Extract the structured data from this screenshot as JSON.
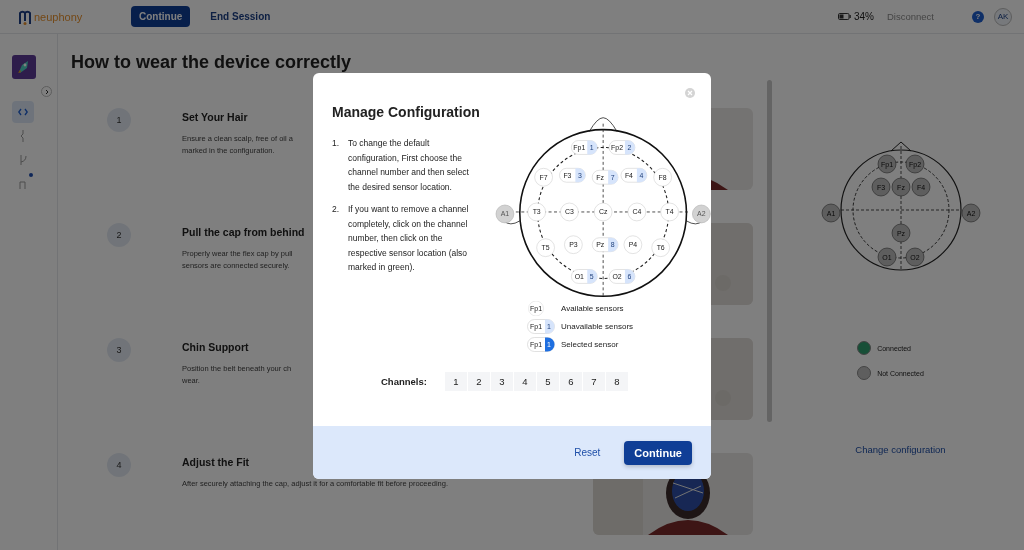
{
  "top_bar": {
    "logo": "neuphony",
    "continue_button": "Continue",
    "end_session": "End Session",
    "battery": "34%",
    "disconnect": {
      "label": "Disconnect",
      "disabled": true
    },
    "help": "?",
    "avatar": "AK"
  },
  "sidebar": {
    "nav": [
      {
        "kind": "code",
        "selected": true,
        "notification": false
      },
      {
        "kind": "pulse",
        "selected": false,
        "notification": false
      },
      {
        "kind": "branch",
        "selected": false,
        "notification": false
      },
      {
        "kind": "route",
        "selected": false,
        "notification": true
      }
    ]
  },
  "page_title": "How to wear the device correctly",
  "steps": [
    {
      "number": "1",
      "title": "Set Your Hair",
      "lines": [
        "Ensure a clean scalp, free of oil a",
        "marked in the configuration."
      ]
    },
    {
      "number": "2",
      "title": "Pull the cap from behind",
      "lines": [
        "Properly wear the flex cap by pull",
        "sensors are connected securely."
      ]
    },
    {
      "number": "3",
      "title": "Chin Support",
      "lines": [
        "Position the belt beneath your ch",
        "wear."
      ]
    },
    {
      "number": "4",
      "title": "Adjust the Fit",
      "lines": [
        "After securely attaching the cap, adjust it for a comfortable fit before proceeding."
      ]
    }
  ],
  "right_panel": {
    "sensors": [
      {
        "label": "Fp1",
        "connected": false
      },
      {
        "label": "Fp2",
        "connected": false
      },
      {
        "label": "F3",
        "connected": false
      },
      {
        "label": "Fz",
        "connected": false
      },
      {
        "label": "F4",
        "connected": false
      },
      {
        "label": "Pz",
        "connected": false
      },
      {
        "label": "O1",
        "connected": false
      },
      {
        "label": "O2",
        "connected": false
      },
      {
        "label": "A1",
        "connected": false
      },
      {
        "label": "A2",
        "connected": false
      }
    ],
    "legend": [
      {
        "kind": "connected",
        "label": "Connected"
      },
      {
        "kind": "not_connected",
        "label": "Not Connected"
      }
    ],
    "link": "Change configuration"
  },
  "dialog": {
    "title": "Manage Configuration",
    "instructions": [
      {
        "number": "1.",
        "text": "To change the default configuration, First choose the channel number and then select the desired sensor location."
      },
      {
        "number": "2.",
        "text": "If you want to remove a channel completely, click on the channel number, then click on the respective sensor location (also marked in green)."
      }
    ],
    "sensors": [
      {
        "label": "Fp1",
        "kind": "electrode",
        "channel": "1",
        "selected": false
      },
      {
        "label": "Fp2",
        "kind": "electrode",
        "channel": "2",
        "selected": false
      },
      {
        "label": "F7",
        "kind": "electrode",
        "selected": false
      },
      {
        "label": "F3",
        "kind": "electrode",
        "channel": "3",
        "selected": false
      },
      {
        "label": "Fz",
        "kind": "electrode",
        "channel": "7",
        "selected": false
      },
      {
        "label": "F4",
        "kind": "electrode",
        "channel": "4",
        "selected": false
      },
      {
        "label": "F8",
        "kind": "electrode",
        "selected": false
      },
      {
        "label": "T3",
        "kind": "electrode",
        "selected": false
      },
      {
        "label": "C3",
        "kind": "electrode",
        "selected": false
      },
      {
        "label": "Cz",
        "kind": "electrode",
        "selected": false
      },
      {
        "label": "C4",
        "kind": "electrode",
        "selected": false
      },
      {
        "label": "T4",
        "kind": "electrode",
        "selected": false
      },
      {
        "label": "T5",
        "kind": "electrode",
        "selected": false
      },
      {
        "label": "P3",
        "kind": "electrode",
        "selected": false
      },
      {
        "label": "Pz",
        "kind": "electrode",
        "channel": "8",
        "selected": false
      },
      {
        "label": "P4",
        "kind": "electrode",
        "selected": false
      },
      {
        "label": "T6",
        "kind": "electrode",
        "selected": false
      },
      {
        "label": "O1",
        "kind": "electrode",
        "channel": "5",
        "selected": false
      },
      {
        "label": "O2",
        "kind": "electrode",
        "channel": "6",
        "selected": false
      },
      {
        "label": "A1",
        "kind": "ear",
        "selected": false
      },
      {
        "label": "A2",
        "kind": "ear",
        "selected": false
      }
    ],
    "legend": [
      {
        "kind": "available",
        "sample": "Fp1",
        "label": "Available sensors"
      },
      {
        "kind": "unavailable",
        "sample": "Fp1",
        "channel": "1",
        "label": "Unavailable sensors"
      },
      {
        "kind": "selected",
        "sample": "Fp1",
        "channel": "1",
        "label": "Selected sensor"
      }
    ],
    "channels_label": "Channels:",
    "channels": [
      {
        "label": "1",
        "selected": false
      },
      {
        "label": "2",
        "selected": false
      },
      {
        "label": "3",
        "selected": false
      },
      {
        "label": "4",
        "selected": false
      },
      {
        "label": "5",
        "selected": false
      },
      {
        "label": "6",
        "selected": false
      },
      {
        "label": "7",
        "selected": false
      },
      {
        "label": "8",
        "selected": false
      }
    ],
    "reset": "Reset",
    "continue": "Continue"
  }
}
